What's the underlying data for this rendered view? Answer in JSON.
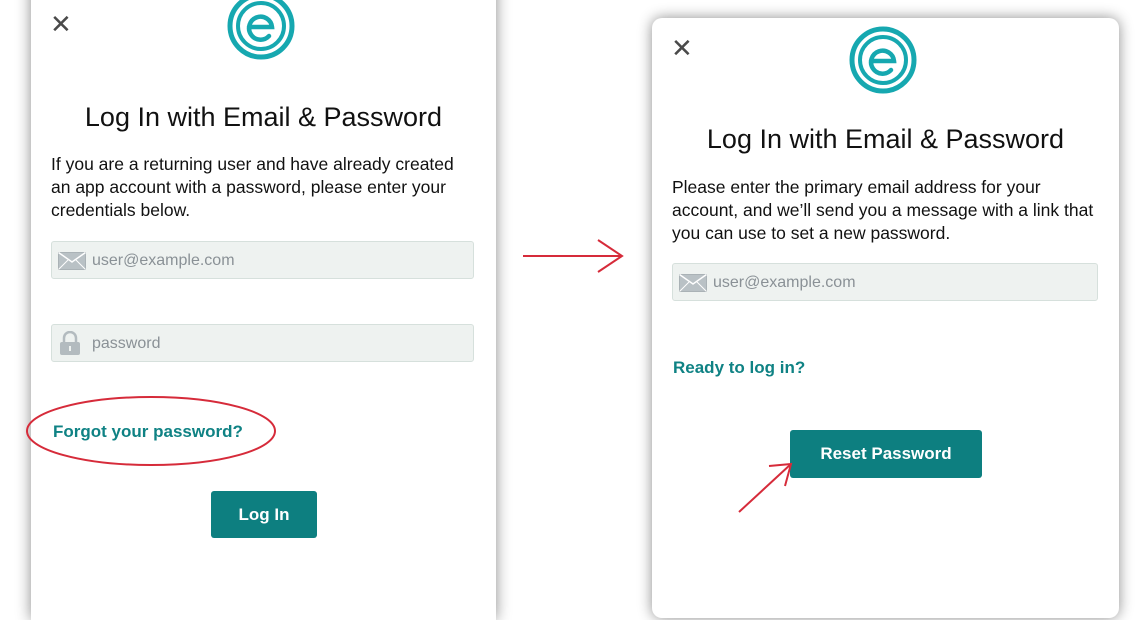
{
  "icons": {
    "close": "close-icon",
    "logo": "e-logo",
    "email": "envelope-icon",
    "password": "lock-icon"
  },
  "colors": {
    "brand_teal": "#16a8b0",
    "button": "#0d7f80",
    "link": "#0f8284",
    "annotation": "#d62b3a"
  },
  "login_screen": {
    "close_glyph": "✕",
    "title": "Log In with Email & Password",
    "description": "If you are a returning user and have already created an app account with a password, please enter your credentials below.",
    "email_placeholder": "user@example.com",
    "password_placeholder": "password",
    "forgot_link": "Forgot your password?",
    "login_button": "Log In"
  },
  "reset_screen": {
    "close_glyph": "✕",
    "title": "Log In with Email & Password",
    "description": "Please enter the primary email address for your account, and we’ll send you a message with a link that you can use to set a new password.",
    "email_placeholder": "user@example.com",
    "ready_link": "Ready to log in?",
    "reset_button": "Reset Password"
  }
}
